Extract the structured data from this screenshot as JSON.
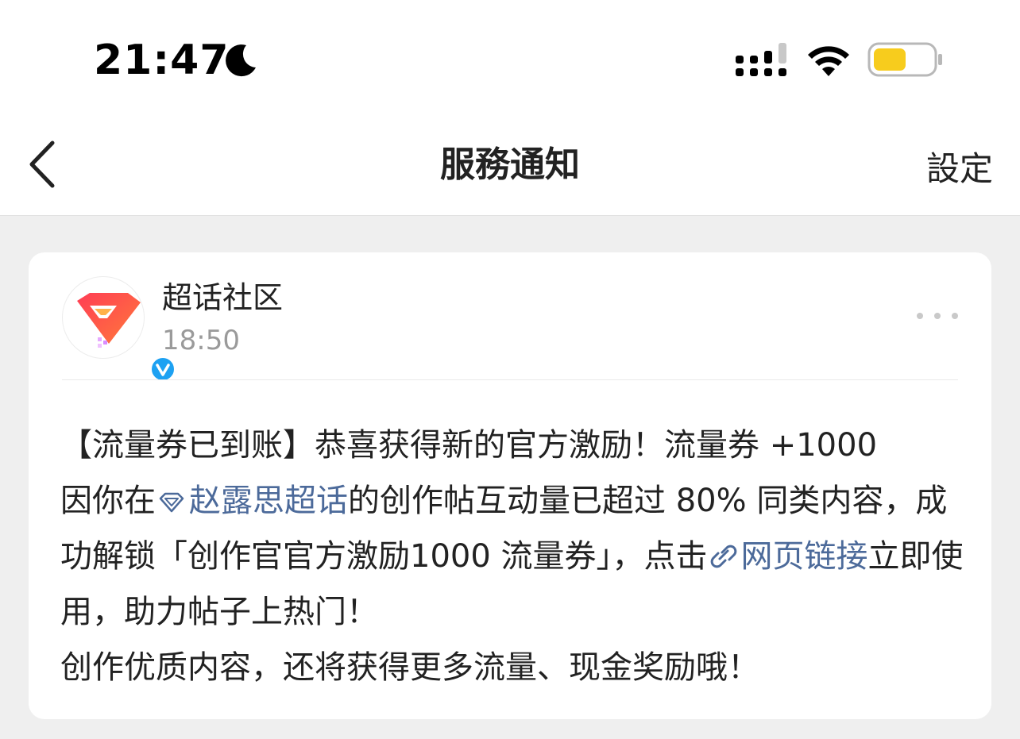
{
  "status_bar": {
    "time": "21:47",
    "icons": [
      "moon-icon",
      "signal-icon",
      "wifi-icon",
      "battery-icon"
    ],
    "battery_color": "#f7cc1d"
  },
  "nav": {
    "back_icon": "chevron-left-icon",
    "title": "服務通知",
    "settings_label": "設定"
  },
  "message": {
    "sender": "超话社区",
    "time": "18:50",
    "avatar_icon": "supertopic-logo-icon",
    "verified_icon": "verified-v-icon",
    "more_icon": "more-dots-icon",
    "body": {
      "line1_prefix": "【流量券已到账】恭喜获得新的官方激励！流量券 +1000",
      "line2_prefix": "因你在",
      "topic_link_icon": "supertopic-diamond-icon",
      "topic_link": "赵露思超话",
      "line2_after_link": "的创作帖互动量已超过 80% 同类内容，成功解锁「创作官官方激励1000 流量券」，点击",
      "web_link_icon": "link-icon",
      "web_link": "网页链接",
      "line3_after_link": "立即使用，助力帖子上热门！",
      "line4": "创作优质内容，还将获得更多流量、现金奖励哦！"
    }
  },
  "colors": {
    "link": "#4c6a9a",
    "verified": "#1da1f2",
    "background": "#efefef"
  }
}
